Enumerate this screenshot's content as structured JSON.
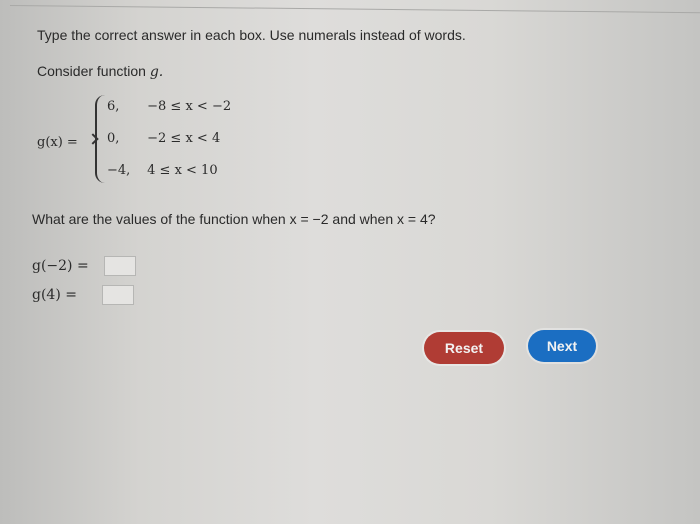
{
  "instruction": "Type the correct answer in each box. Use numerals instead of words.",
  "consider_prefix": "Consider function ",
  "consider_var": "g.",
  "function": {
    "lhs": "g(x) =",
    "cases": [
      {
        "value": "6,",
        "condition": "−8 ≤ x < −2"
      },
      {
        "value": "0,",
        "condition": "−2 ≤ x < 4"
      },
      {
        "value": "−4,",
        "condition": "4 ≤ x < 10"
      }
    ]
  },
  "question": "What are the values of the function when x = −2 and when x = 4?",
  "answers": [
    {
      "label": "g(−2) =",
      "value": ""
    },
    {
      "label": "g(4) =",
      "value": ""
    }
  ],
  "buttons": {
    "reset": "Reset",
    "next": "Next"
  },
  "colors": {
    "reset": "#b03c34",
    "next": "#1b6ec2"
  }
}
